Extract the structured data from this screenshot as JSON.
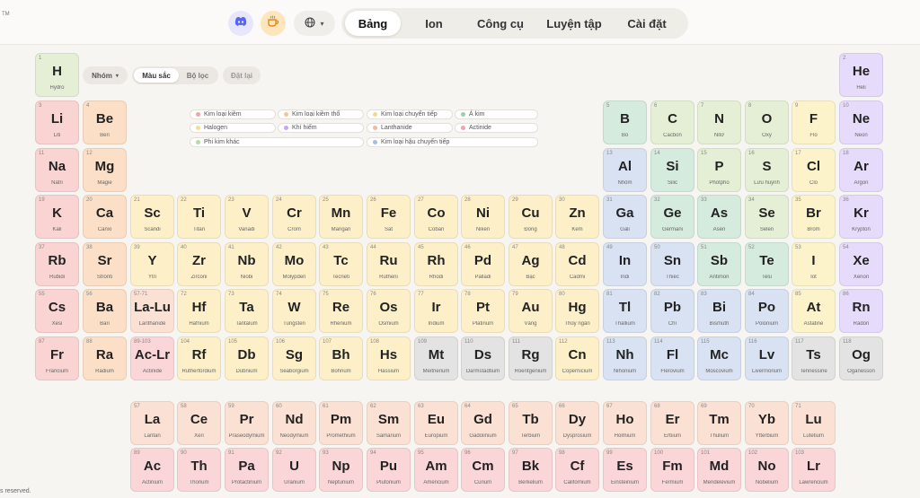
{
  "header": {
    "trademark": "TM",
    "discord_icon": "discord-icon",
    "coffee_icon": "coffee-icon",
    "globe_icon": "globe-icon",
    "tabs": [
      {
        "label": "Bảng",
        "active": true
      },
      {
        "label": "Ion",
        "active": false
      },
      {
        "label": "Công cụ",
        "active": false
      },
      {
        "label": "Luyện tập",
        "active": false
      },
      {
        "label": "Cài đặt",
        "active": false
      }
    ]
  },
  "controls": {
    "group_label": "Nhóm",
    "color_label": "Màu sắc",
    "filter_label": "Bộ lọc",
    "reset_label": "Đặt lại"
  },
  "legend": [
    {
      "label": "Kim loại kiềm",
      "color": "#f2a5a5"
    },
    {
      "label": "Kim loại kiềm thổ",
      "color": "#f6c39a"
    },
    {
      "label": "Kim loại chuyển tiếp",
      "color": "#f7d98a"
    },
    {
      "label": "Á kim",
      "color": "#94d1ad"
    },
    {
      "label": "Halogen",
      "color": "#f2e08e"
    },
    {
      "label": "Khí hiếm",
      "color": "#c3a8f3"
    },
    {
      "label": "Lanthanide",
      "color": "#f5b89a"
    },
    {
      "label": "Actinide",
      "color": "#f2a3a8"
    },
    {
      "label": "Phi kim khác",
      "color": "#b8d9a0"
    },
    {
      "label": "Kim loại hậu chuyển tiếp",
      "color": "#a9bde3"
    }
  ],
  "colors": {
    "am": "#fad3d3",
    "ae": "#fbdfc6",
    "tm": "#fdf0c9",
    "pt": "#d9e2f2",
    "me": "#d5ebde",
    "nm": "#e5efd6",
    "ha": "#fcf3cb",
    "ng": "#e6dbfb",
    "la": "#fbe1d4",
    "ac": "#fbd6d8",
    "un": "#e3e3e3"
  },
  "elements": [
    {
      "n": "1",
      "s": "H",
      "name": "Hydro",
      "c": "nm"
    },
    {
      "n": "2",
      "s": "He",
      "name": "Heli",
      "c": "ng"
    },
    {
      "n": "3",
      "s": "Li",
      "name": "Liti",
      "c": "am"
    },
    {
      "n": "4",
      "s": "Be",
      "name": "Beri",
      "c": "ae"
    },
    {
      "n": "5",
      "s": "B",
      "name": "Bo",
      "c": "me"
    },
    {
      "n": "6",
      "s": "C",
      "name": "Cacbon",
      "c": "nm"
    },
    {
      "n": "7",
      "s": "N",
      "name": "Nitơ",
      "c": "nm"
    },
    {
      "n": "8",
      "s": "O",
      "name": "Oxy",
      "c": "nm"
    },
    {
      "n": "9",
      "s": "F",
      "name": "Flo",
      "c": "ha"
    },
    {
      "n": "10",
      "s": "Ne",
      "name": "Neon",
      "c": "ng"
    },
    {
      "n": "11",
      "s": "Na",
      "name": "Natri",
      "c": "am"
    },
    {
      "n": "12",
      "s": "Mg",
      "name": "Magie",
      "c": "ae"
    },
    {
      "n": "13",
      "s": "Al",
      "name": "Nhôm",
      "c": "pt"
    },
    {
      "n": "14",
      "s": "Si",
      "name": "Silic",
      "c": "me"
    },
    {
      "n": "15",
      "s": "P",
      "name": "Photpho",
      "c": "nm"
    },
    {
      "n": "16",
      "s": "S",
      "name": "Lưu huỳnh",
      "c": "nm"
    },
    {
      "n": "17",
      "s": "Cl",
      "name": "Clo",
      "c": "ha"
    },
    {
      "n": "18",
      "s": "Ar",
      "name": "Argon",
      "c": "ng"
    },
    {
      "n": "19",
      "s": "K",
      "name": "Kali",
      "c": "am"
    },
    {
      "n": "20",
      "s": "Ca",
      "name": "Canxi",
      "c": "ae"
    },
    {
      "n": "21",
      "s": "Sc",
      "name": "Scandi",
      "c": "tm"
    },
    {
      "n": "22",
      "s": "Ti",
      "name": "Titan",
      "c": "tm"
    },
    {
      "n": "23",
      "s": "V",
      "name": "Vanadi",
      "c": "tm"
    },
    {
      "n": "24",
      "s": "Cr",
      "name": "Crom",
      "c": "tm"
    },
    {
      "n": "25",
      "s": "Mn",
      "name": "Mangan",
      "c": "tm"
    },
    {
      "n": "26",
      "s": "Fe",
      "name": "Sắt",
      "c": "tm"
    },
    {
      "n": "27",
      "s": "Co",
      "name": "Coban",
      "c": "tm"
    },
    {
      "n": "28",
      "s": "Ni",
      "name": "Niken",
      "c": "tm"
    },
    {
      "n": "29",
      "s": "Cu",
      "name": "Đồng",
      "c": "tm"
    },
    {
      "n": "30",
      "s": "Zn",
      "name": "Kẽm",
      "c": "tm"
    },
    {
      "n": "31",
      "s": "Ga",
      "name": "Gali",
      "c": "pt"
    },
    {
      "n": "32",
      "s": "Ge",
      "name": "Germani",
      "c": "me"
    },
    {
      "n": "33",
      "s": "As",
      "name": "Asen",
      "c": "me"
    },
    {
      "n": "34",
      "s": "Se",
      "name": "Selen",
      "c": "nm"
    },
    {
      "n": "35",
      "s": "Br",
      "name": "Brom",
      "c": "ha"
    },
    {
      "n": "36",
      "s": "Kr",
      "name": "Krypton",
      "c": "ng"
    },
    {
      "n": "37",
      "s": "Rb",
      "name": "Rubidi",
      "c": "am"
    },
    {
      "n": "38",
      "s": "Sr",
      "name": "Stronti",
      "c": "ae"
    },
    {
      "n": "39",
      "s": "Y",
      "name": "Ytri",
      "c": "tm"
    },
    {
      "n": "40",
      "s": "Zr",
      "name": "Zirconi",
      "c": "tm"
    },
    {
      "n": "41",
      "s": "Nb",
      "name": "Niobi",
      "c": "tm"
    },
    {
      "n": "42",
      "s": "Mo",
      "name": "Molypden",
      "c": "tm"
    },
    {
      "n": "43",
      "s": "Tc",
      "name": "Tecneti",
      "c": "tm"
    },
    {
      "n": "44",
      "s": "Ru",
      "name": "Rutheni",
      "c": "tm"
    },
    {
      "n": "45",
      "s": "Rh",
      "name": "Rhodi",
      "c": "tm"
    },
    {
      "n": "46",
      "s": "Pd",
      "name": "Palladi",
      "c": "tm"
    },
    {
      "n": "47",
      "s": "Ag",
      "name": "Bạc",
      "c": "tm"
    },
    {
      "n": "48",
      "s": "Cd",
      "name": "Cadmi",
      "c": "tm"
    },
    {
      "n": "49",
      "s": "In",
      "name": "Indi",
      "c": "pt"
    },
    {
      "n": "50",
      "s": "Sn",
      "name": "Thiếc",
      "c": "pt"
    },
    {
      "n": "51",
      "s": "Sb",
      "name": "Antimon",
      "c": "me"
    },
    {
      "n": "52",
      "s": "Te",
      "name": "Telu",
      "c": "me"
    },
    {
      "n": "53",
      "s": "I",
      "name": "Iot",
      "c": "ha"
    },
    {
      "n": "54",
      "s": "Xe",
      "name": "Xenon",
      "c": "ng"
    },
    {
      "n": "55",
      "s": "Cs",
      "name": "Xesi",
      "c": "am"
    },
    {
      "n": "56",
      "s": "Ba",
      "name": "Bari",
      "c": "ae"
    },
    {
      "n": "57-71",
      "s": "La-Lu",
      "name": "Lanthanide",
      "c": "la"
    },
    {
      "n": "72",
      "s": "Hf",
      "name": "Hafnium",
      "c": "tm"
    },
    {
      "n": "73",
      "s": "Ta",
      "name": "Tantalum",
      "c": "tm"
    },
    {
      "n": "74",
      "s": "W",
      "name": "Tungsten",
      "c": "tm"
    },
    {
      "n": "75",
      "s": "Re",
      "name": "Rhenium",
      "c": "tm"
    },
    {
      "n": "76",
      "s": "Os",
      "name": "Osmium",
      "c": "tm"
    },
    {
      "n": "77",
      "s": "Ir",
      "name": "Iridium",
      "c": "tm"
    },
    {
      "n": "78",
      "s": "Pt",
      "name": "Platinum",
      "c": "tm"
    },
    {
      "n": "79",
      "s": "Au",
      "name": "Vàng",
      "c": "tm"
    },
    {
      "n": "80",
      "s": "Hg",
      "name": "Thủy ngân",
      "c": "tm"
    },
    {
      "n": "81",
      "s": "Tl",
      "name": "Thallium",
      "c": "pt"
    },
    {
      "n": "82",
      "s": "Pb",
      "name": "Chì",
      "c": "pt"
    },
    {
      "n": "83",
      "s": "Bi",
      "name": "Bismuth",
      "c": "pt"
    },
    {
      "n": "84",
      "s": "Po",
      "name": "Polonium",
      "c": "pt"
    },
    {
      "n": "85",
      "s": "At",
      "name": "Astatine",
      "c": "ha"
    },
    {
      "n": "86",
      "s": "Rn",
      "name": "Radon",
      "c": "ng"
    },
    {
      "n": "87",
      "s": "Fr",
      "name": "Francium",
      "c": "am"
    },
    {
      "n": "88",
      "s": "Ra",
      "name": "Radium",
      "c": "ae"
    },
    {
      "n": "89-103",
      "s": "Ac-Lr",
      "name": "Actinide",
      "c": "ac"
    },
    {
      "n": "104",
      "s": "Rf",
      "name": "Rutherfordium",
      "c": "tm"
    },
    {
      "n": "105",
      "s": "Db",
      "name": "Dubnium",
      "c": "tm"
    },
    {
      "n": "106",
      "s": "Sg",
      "name": "Seaborgium",
      "c": "tm"
    },
    {
      "n": "107",
      "s": "Bh",
      "name": "Bohrium",
      "c": "tm"
    },
    {
      "n": "108",
      "s": "Hs",
      "name": "Hassium",
      "c": "tm"
    },
    {
      "n": "109",
      "s": "Mt",
      "name": "Meitnerium",
      "c": "un"
    },
    {
      "n": "110",
      "s": "Ds",
      "name": "Darmstadtium",
      "c": "un"
    },
    {
      "n": "111",
      "s": "Rg",
      "name": "Roentgenium",
      "c": "un"
    },
    {
      "n": "112",
      "s": "Cn",
      "name": "Copernicium",
      "c": "tm"
    },
    {
      "n": "113",
      "s": "Nh",
      "name": "Nihonium",
      "c": "pt"
    },
    {
      "n": "114",
      "s": "Fl",
      "name": "Flerovium",
      "c": "pt"
    },
    {
      "n": "115",
      "s": "Mc",
      "name": "Moscovium",
      "c": "pt"
    },
    {
      "n": "116",
      "s": "Lv",
      "name": "Livermorium",
      "c": "pt"
    },
    {
      "n": "117",
      "s": "Ts",
      "name": "Tennessine",
      "c": "un"
    },
    {
      "n": "118",
      "s": "Og",
      "name": "Oganesson",
      "c": "un"
    },
    {
      "n": "57",
      "s": "La",
      "name": "Lantan",
      "c": "la"
    },
    {
      "n": "58",
      "s": "Ce",
      "name": "Xeri",
      "c": "la"
    },
    {
      "n": "59",
      "s": "Pr",
      "name": "Praseodymium",
      "c": "la"
    },
    {
      "n": "60",
      "s": "Nd",
      "name": "Neodymium",
      "c": "la"
    },
    {
      "n": "61",
      "s": "Pm",
      "name": "Promethium",
      "c": "la"
    },
    {
      "n": "62",
      "s": "Sm",
      "name": "Samarium",
      "c": "la"
    },
    {
      "n": "63",
      "s": "Eu",
      "name": "Europium",
      "c": "la"
    },
    {
      "n": "64",
      "s": "Gd",
      "name": "Gadolinium",
      "c": "la"
    },
    {
      "n": "65",
      "s": "Tb",
      "name": "Terbium",
      "c": "la"
    },
    {
      "n": "66",
      "s": "Dy",
      "name": "Dysprosium",
      "c": "la"
    },
    {
      "n": "67",
      "s": "Ho",
      "name": "Holmium",
      "c": "la"
    },
    {
      "n": "68",
      "s": "Er",
      "name": "Erbium",
      "c": "la"
    },
    {
      "n": "69",
      "s": "Tm",
      "name": "Thulium",
      "c": "la"
    },
    {
      "n": "70",
      "s": "Yb",
      "name": "Ytterbium",
      "c": "la"
    },
    {
      "n": "71",
      "s": "Lu",
      "name": "Lutetium",
      "c": "la"
    },
    {
      "n": "89",
      "s": "Ac",
      "name": "Actinium",
      "c": "ac"
    },
    {
      "n": "90",
      "s": "Th",
      "name": "Thorium",
      "c": "ac"
    },
    {
      "n": "91",
      "s": "Pa",
      "name": "Protactinium",
      "c": "ac"
    },
    {
      "n": "92",
      "s": "U",
      "name": "Uranium",
      "c": "ac"
    },
    {
      "n": "93",
      "s": "Np",
      "name": "Neptunium",
      "c": "ac"
    },
    {
      "n": "94",
      "s": "Pu",
      "name": "Plutonium",
      "c": "ac"
    },
    {
      "n": "95",
      "s": "Am",
      "name": "Americium",
      "c": "ac"
    },
    {
      "n": "96",
      "s": "Cm",
      "name": "Curium",
      "c": "ac"
    },
    {
      "n": "97",
      "s": "Bk",
      "name": "Berkelium",
      "c": "ac"
    },
    {
      "n": "98",
      "s": "Cf",
      "name": "Californium",
      "c": "ac"
    },
    {
      "n": "99",
      "s": "Es",
      "name": "Einsteinium",
      "c": "ac"
    },
    {
      "n": "100",
      "s": "Fm",
      "name": "Fermium",
      "c": "ac"
    },
    {
      "n": "101",
      "s": "Md",
      "name": "Mendelevium",
      "c": "ac"
    },
    {
      "n": "102",
      "s": "No",
      "name": "Nobelium",
      "c": "ac"
    },
    {
      "n": "103",
      "s": "Lr",
      "name": "Lawrencium",
      "c": "ac"
    }
  ],
  "footer": {
    "text": "s reserved."
  }
}
